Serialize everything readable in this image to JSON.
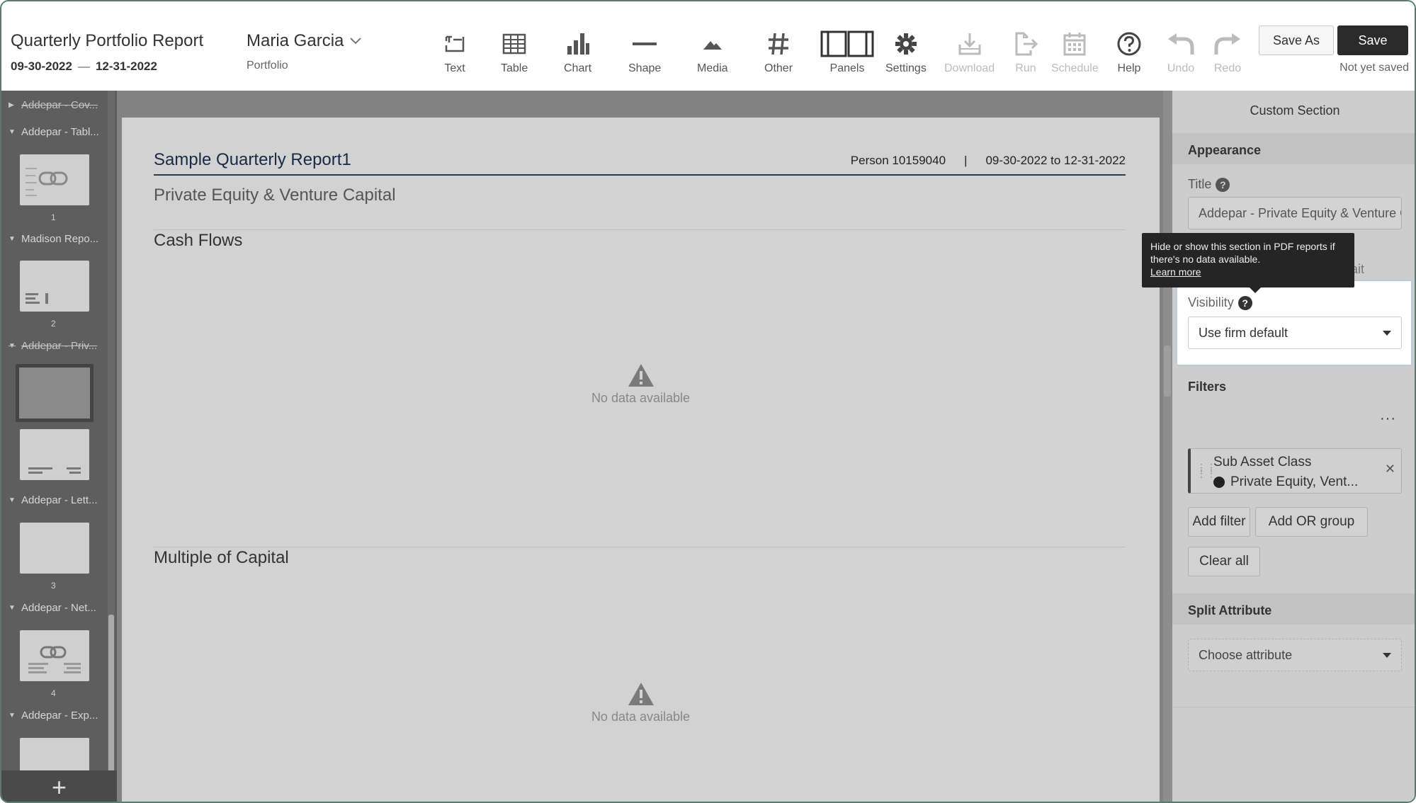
{
  "header": {
    "report_title": "Quarterly Portfolio Report",
    "date_start": "09-30-2022",
    "date_separator": "—",
    "date_end": "12-31-2022",
    "owner_name": "Maria Garcia",
    "owner_type": "Portfolio"
  },
  "tools": [
    {
      "label": "Text",
      "icon": "text-icon",
      "enabled": true
    },
    {
      "label": "Table",
      "icon": "table-icon",
      "enabled": true
    },
    {
      "label": "Chart",
      "icon": "chart-icon",
      "enabled": true
    },
    {
      "label": "Shape",
      "icon": "shape-icon",
      "enabled": true
    },
    {
      "label": "Media",
      "icon": "media-icon",
      "enabled": true
    },
    {
      "label": "Other",
      "icon": "hash-icon",
      "enabled": true
    },
    {
      "label": "Panels",
      "icon": "panels-icon",
      "enabled": true
    },
    {
      "label": "Settings",
      "icon": "gear-icon",
      "enabled": true
    },
    {
      "label": "Download",
      "icon": "download-icon",
      "enabled": false
    },
    {
      "label": "Run",
      "icon": "run-icon",
      "enabled": false
    },
    {
      "label": "Schedule",
      "icon": "calendar-icon",
      "enabled": false
    },
    {
      "label": "Help",
      "icon": "help-icon",
      "enabled": true
    },
    {
      "label": "Undo",
      "icon": "undo-icon",
      "enabled": false
    },
    {
      "label": "Redo",
      "icon": "redo-icon",
      "enabled": false
    }
  ],
  "actions": {
    "save_as_label": "Save As",
    "save_label": "Save",
    "save_status": "Not yet saved"
  },
  "sidebar": {
    "groups": [
      {
        "label": "Addepar - Cov...",
        "strikethrough": true,
        "collapsed": true
      },
      {
        "label": "Addepar - Tabl...",
        "strikethrough": false,
        "collapsed": false
      },
      {
        "label": "Madison Repo...",
        "strikethrough": false,
        "collapsed": false
      },
      {
        "label": "Addepar - Priv...",
        "strikethrough": true,
        "collapsed": false
      },
      {
        "label": "Addepar - Lett...",
        "strikethrough": false,
        "collapsed": false
      },
      {
        "label": "Addepar - Net...",
        "strikethrough": false,
        "collapsed": false
      },
      {
        "label": "Addepar - Exp...",
        "strikethrough": false,
        "collapsed": false
      }
    ],
    "page_numbers": [
      "1",
      "2",
      "3",
      "4"
    ],
    "add_label": "+"
  },
  "report": {
    "title": "Sample Quarterly Report1",
    "person": "Person 10159040",
    "meta_separator": "|",
    "date_range": "09-30-2022 to 12-31-2022",
    "subtitle": "Private Equity & Venture Capital",
    "sections": [
      {
        "title": "Cash Flows",
        "empty_message": "No data available"
      },
      {
        "title": "Multiple of Capital",
        "empty_message": "No data available"
      }
    ]
  },
  "panel": {
    "title": "Custom Section",
    "appearance_heading": "Appearance",
    "title_label": "Title",
    "title_value": "Addepar - Private Equity & Venture Capital",
    "hidden_label_fragment": "ait",
    "tooltip_text": "Hide or show this section in PDF reports if there's no data available.",
    "tooltip_link": "Learn more",
    "visibility_label": "Visibility",
    "visibility_value": "Use firm default",
    "filters_heading": "Filters",
    "more_label": "···",
    "filter": {
      "name": "Sub Asset Class",
      "value": "Private Equity, Vent..."
    },
    "add_filter_label": "Add filter",
    "add_or_group_label": "Add OR group",
    "clear_all_label": "Clear all",
    "split_heading": "Split Attribute",
    "split_placeholder": "Choose attribute"
  },
  "colors": {
    "dark_button": "#2a2a2a",
    "overlay_gray": "#828282",
    "tooltip_bg": "#252525"
  }
}
